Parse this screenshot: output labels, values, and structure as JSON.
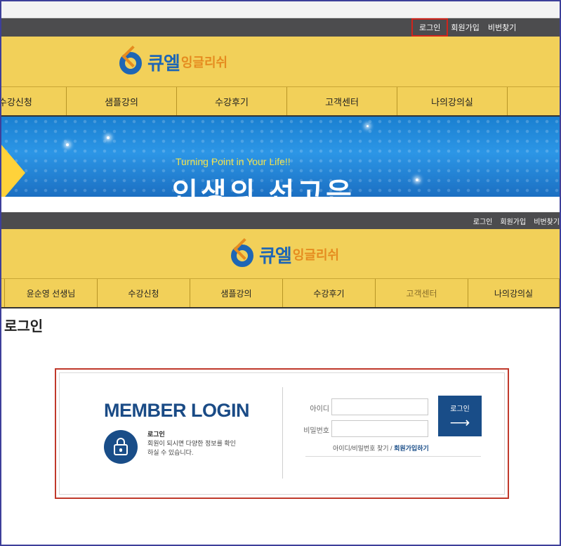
{
  "top": {
    "util_links": [
      "로그인",
      "회원가입",
      "비번찾기"
    ],
    "logo": {
      "kor": "큐엘",
      "sub": "잉글리쉬"
    },
    "nav": [
      "수강신청",
      "샘플강의",
      "수강후기",
      "고객센터",
      "나의강의실"
    ],
    "banner": {
      "tagline": "Turning Point in Your Life!!",
      "headline": "인생의 선고은"
    }
  },
  "bottom": {
    "util_links": [
      "로그인",
      "회원가입",
      "비번찾기"
    ],
    "logo": {
      "kor": "큐엘",
      "sub": "잉글리쉬"
    },
    "nav": [
      "윤순영 선생님",
      "수강신청",
      "샘플강의",
      "수강후기",
      "고객센터",
      "나의강의실"
    ],
    "active_nav": "고객센터",
    "page_title": "로그인",
    "login": {
      "heading": "MEMBER LOGIN",
      "sub": "로그인",
      "desc": "회원이 되시면 다양한 정보를 확인하실 수 있습니다.",
      "id_label": "아이디",
      "pw_label": "비밀번호",
      "id_value": "",
      "pw_value": "",
      "button_label": "로그인",
      "button_arrow": "⟶",
      "find_link": "아이디/비밀번호 찾기",
      "separator": "/",
      "join_link": "회원가입하기"
    }
  },
  "colors": {
    "header_yellow": "#f2d059",
    "util_bar": "#4c4c4e",
    "brand_blue": "#194d88",
    "highlight_red": "#c0392b"
  }
}
